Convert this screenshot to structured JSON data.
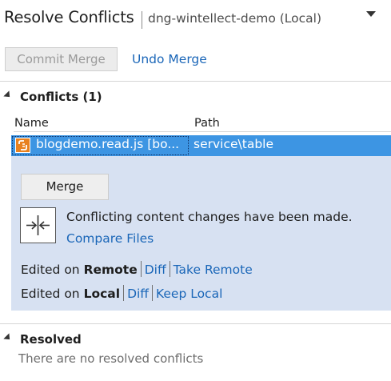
{
  "header": {
    "title": "Resolve Conflicts",
    "repo": "dng-wintellect-demo (Local)",
    "dropdown_icon": "triangle-down-icon"
  },
  "toolbar": {
    "commit_merge": "Commit Merge",
    "undo_merge": "Undo Merge"
  },
  "conflicts": {
    "heading": "Conflicts (1)",
    "columns": {
      "name": "Name",
      "path": "Path"
    },
    "rows": [
      {
        "name": "blogdemo.read.js [bo...",
        "path": "service\\table",
        "icon": "js-file-icon",
        "selected": true
      }
    ],
    "detail": {
      "merge_button": "Merge",
      "message": "Conflicting content changes have been made.",
      "compare_files": "Compare Files",
      "remote": {
        "prefix": "Edited on",
        "side": "Remote",
        "diff": "Diff",
        "take": "Take Remote"
      },
      "local": {
        "prefix": "Edited on",
        "side": "Local",
        "diff": "Diff",
        "keep": "Keep Local"
      }
    }
  },
  "resolved": {
    "heading": "Resolved",
    "empty": "There are no resolved conflicts"
  },
  "colors": {
    "accent_link": "#1a66b8",
    "selection": "#3d95e3",
    "detail_bg": "#d7e1f2",
    "js_icon": "#e8811f"
  }
}
